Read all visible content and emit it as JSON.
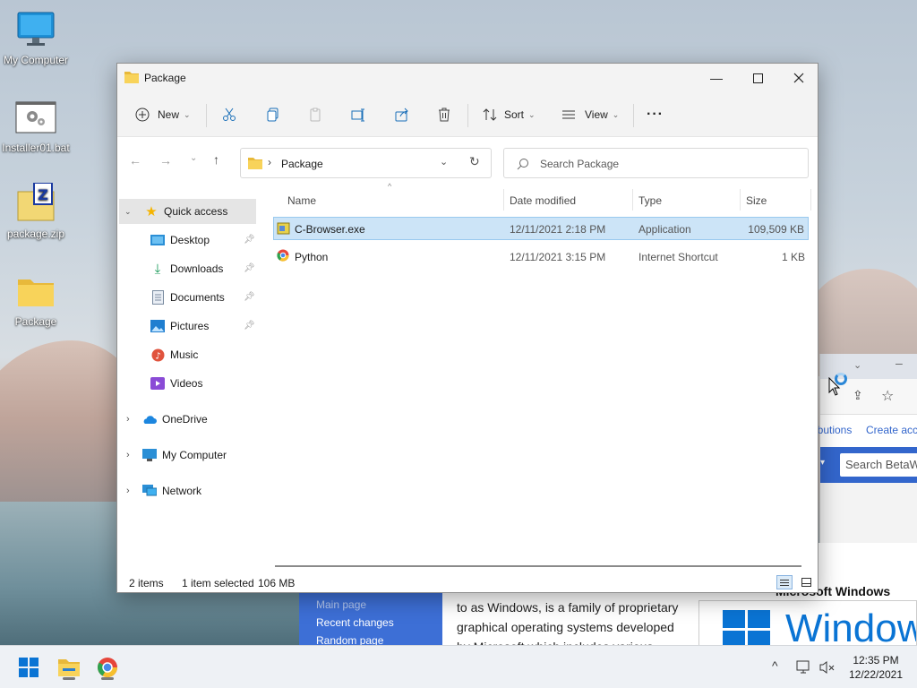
{
  "desktop": {
    "icons": [
      {
        "label": "My Computer"
      },
      {
        "label": "Installer01.bat"
      },
      {
        "label": "package.zip"
      },
      {
        "label": "Package"
      }
    ]
  },
  "background_browser": {
    "links": {
      "contributions": "ributions",
      "create_account": "Create acc"
    },
    "search_placeholder": "Search BetaW",
    "sidebar": [
      "Main page",
      "Recent changes",
      "Random page"
    ],
    "article_lines": [
      "to as Windows, is a family of proprietary",
      "graphical operating systems developed",
      "by Microsoft which includes various"
    ],
    "infobox_title": "Microsoft Windows",
    "logo_text": "Window"
  },
  "explorer": {
    "title": "Package",
    "toolbar": {
      "new_label": "New",
      "sort_label": "Sort",
      "view_label": "View",
      "more_label": "···"
    },
    "address": {
      "path": "Package",
      "search_placeholder": "Search Package"
    },
    "nav": {
      "quick_access": "Quick access",
      "items": [
        "Desktop",
        "Downloads",
        "Documents",
        "Pictures",
        "Music",
        "Videos"
      ],
      "onedrive": "OneDrive",
      "my_computer": "My Computer",
      "network": "Network"
    },
    "columns": {
      "name": "Name",
      "date": "Date modified",
      "type": "Type",
      "size": "Size"
    },
    "files": [
      {
        "name": "C-Browser.exe",
        "date": "12/11/2021 2:18 PM",
        "type": "Application",
        "size": "109,509 KB",
        "selected": true
      },
      {
        "name": "Python",
        "date": "12/11/2021 3:15 PM",
        "type": "Internet Shortcut",
        "size": "1 KB",
        "selected": false
      }
    ],
    "status": {
      "count": "2 items",
      "selected": "1 item selected",
      "size": "106 MB"
    }
  },
  "taskbar": {
    "time": "12:35 PM",
    "date": "12/22/2021"
  },
  "colors": {
    "accent": "#0067c0",
    "selection": "#cce4f7",
    "folder": "#f8c84a"
  }
}
